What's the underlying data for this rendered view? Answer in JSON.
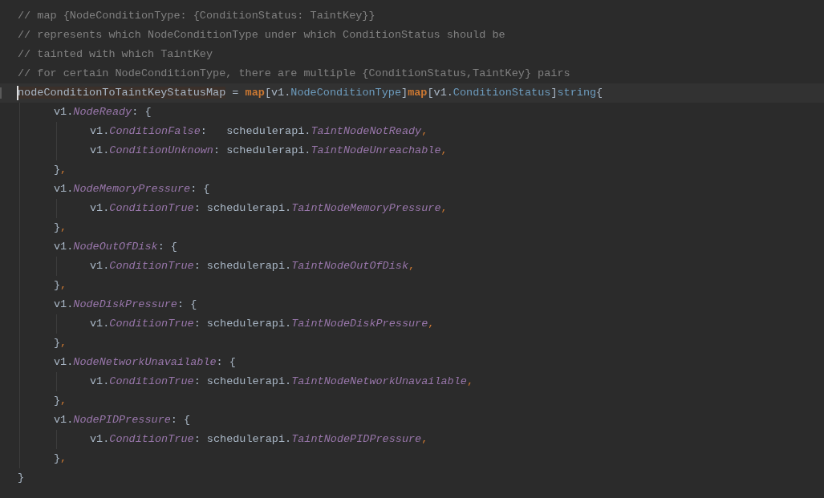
{
  "editor": {
    "lines": [
      {
        "current": false,
        "tokens": [
          {
            "kind": "comment",
            "text": "// map {NodeConditionType: {ConditionStatus: TaintKey}}"
          }
        ]
      },
      {
        "current": false,
        "tokens": [
          {
            "kind": "comment",
            "text": "// represents which NodeConditionType under which ConditionStatus should be"
          }
        ]
      },
      {
        "current": false,
        "tokens": [
          {
            "kind": "comment",
            "text": "// tainted with which TaintKey"
          }
        ]
      },
      {
        "current": false,
        "tokens": [
          {
            "kind": "comment",
            "text": "// for certain NodeConditionType, there are multiple {ConditionStatus,TaintKey} pairs"
          }
        ]
      },
      {
        "current": true,
        "tokens": [
          {
            "kind": "usage",
            "text": "nodeConditionToTaintKeyStatusMap"
          },
          {
            "kind": "plain",
            "text": " = "
          },
          {
            "kind": "keyword",
            "text": "map"
          },
          {
            "kind": "plain",
            "text": "[v1."
          },
          {
            "kind": "type",
            "text": "NodeConditionType"
          },
          {
            "kind": "plain",
            "text": "]"
          },
          {
            "kind": "keyword",
            "text": "map"
          },
          {
            "kind": "plain",
            "text": "[v1."
          },
          {
            "kind": "type",
            "text": "ConditionStatus"
          },
          {
            "kind": "plain",
            "text": "]"
          },
          {
            "kind": "type",
            "text": "string"
          },
          {
            "kind": "plain",
            "text": "{"
          }
        ],
        "children": [
          {
            "current": false,
            "tokens": [
              {
                "kind": "plain",
                "text": "v1."
              },
              {
                "kind": "field",
                "text": "NodeReady"
              },
              {
                "kind": "plain",
                "text": ": {"
              }
            ],
            "children": [
              {
                "current": false,
                "tokens": [
                  {
                    "kind": "plain",
                    "text": "v1."
                  },
                  {
                    "kind": "field",
                    "text": "ConditionFalse"
                  },
                  {
                    "kind": "plain",
                    "text": ":   schedulerapi."
                  },
                  {
                    "kind": "field",
                    "text": "TaintNodeNotReady"
                  },
                  {
                    "kind": "punct",
                    "text": ","
                  }
                ]
              },
              {
                "current": false,
                "tokens": [
                  {
                    "kind": "plain",
                    "text": "v1."
                  },
                  {
                    "kind": "field",
                    "text": "ConditionUnknown"
                  },
                  {
                    "kind": "plain",
                    "text": ": schedulerapi."
                  },
                  {
                    "kind": "field",
                    "text": "TaintNodeUnreachable"
                  },
                  {
                    "kind": "punct",
                    "text": ","
                  }
                ]
              }
            ]
          },
          {
            "current": false,
            "tokens": [
              {
                "kind": "plain",
                "text": "}"
              },
              {
                "kind": "punct",
                "text": ","
              }
            ]
          },
          {
            "current": false,
            "tokens": [
              {
                "kind": "plain",
                "text": "v1."
              },
              {
                "kind": "field",
                "text": "NodeMemoryPressure"
              },
              {
                "kind": "plain",
                "text": ": {"
              }
            ],
            "children": [
              {
                "current": false,
                "tokens": [
                  {
                    "kind": "plain",
                    "text": "v1."
                  },
                  {
                    "kind": "field",
                    "text": "ConditionTrue"
                  },
                  {
                    "kind": "plain",
                    "text": ": schedulerapi."
                  },
                  {
                    "kind": "field",
                    "text": "TaintNodeMemoryPressure"
                  },
                  {
                    "kind": "punct",
                    "text": ","
                  }
                ]
              }
            ]
          },
          {
            "current": false,
            "tokens": [
              {
                "kind": "plain",
                "text": "}"
              },
              {
                "kind": "punct",
                "text": ","
              }
            ]
          },
          {
            "current": false,
            "tokens": [
              {
                "kind": "plain",
                "text": "v1."
              },
              {
                "kind": "field",
                "text": "NodeOutOfDisk"
              },
              {
                "kind": "plain",
                "text": ": {"
              }
            ],
            "children": [
              {
                "current": false,
                "tokens": [
                  {
                    "kind": "plain",
                    "text": "v1."
                  },
                  {
                    "kind": "field",
                    "text": "ConditionTrue"
                  },
                  {
                    "kind": "plain",
                    "text": ": schedulerapi."
                  },
                  {
                    "kind": "field",
                    "text": "TaintNodeOutOfDisk"
                  },
                  {
                    "kind": "punct",
                    "text": ","
                  }
                ]
              }
            ]
          },
          {
            "current": false,
            "tokens": [
              {
                "kind": "plain",
                "text": "}"
              },
              {
                "kind": "punct",
                "text": ","
              }
            ]
          },
          {
            "current": false,
            "tokens": [
              {
                "kind": "plain",
                "text": "v1."
              },
              {
                "kind": "field",
                "text": "NodeDiskPressure"
              },
              {
                "kind": "plain",
                "text": ": {"
              }
            ],
            "children": [
              {
                "current": false,
                "tokens": [
                  {
                    "kind": "plain",
                    "text": "v1."
                  },
                  {
                    "kind": "field",
                    "text": "ConditionTrue"
                  },
                  {
                    "kind": "plain",
                    "text": ": schedulerapi."
                  },
                  {
                    "kind": "field",
                    "text": "TaintNodeDiskPressure"
                  },
                  {
                    "kind": "punct",
                    "text": ","
                  }
                ]
              }
            ]
          },
          {
            "current": false,
            "tokens": [
              {
                "kind": "plain",
                "text": "}"
              },
              {
                "kind": "punct",
                "text": ","
              }
            ]
          },
          {
            "current": false,
            "tokens": [
              {
                "kind": "plain",
                "text": "v1."
              },
              {
                "kind": "field",
                "text": "NodeNetworkUnavailable"
              },
              {
                "kind": "plain",
                "text": ": {"
              }
            ],
            "children": [
              {
                "current": false,
                "tokens": [
                  {
                    "kind": "plain",
                    "text": "v1."
                  },
                  {
                    "kind": "field",
                    "text": "ConditionTrue"
                  },
                  {
                    "kind": "plain",
                    "text": ": schedulerapi."
                  },
                  {
                    "kind": "field",
                    "text": "TaintNodeNetworkUnavailable"
                  },
                  {
                    "kind": "punct",
                    "text": ","
                  }
                ]
              }
            ]
          },
          {
            "current": false,
            "tokens": [
              {
                "kind": "plain",
                "text": "}"
              },
              {
                "kind": "punct",
                "text": ","
              }
            ]
          },
          {
            "current": false,
            "tokens": [
              {
                "kind": "plain",
                "text": "v1."
              },
              {
                "kind": "field",
                "text": "NodePIDPressure"
              },
              {
                "kind": "plain",
                "text": ": {"
              }
            ],
            "children": [
              {
                "current": false,
                "tokens": [
                  {
                    "kind": "plain",
                    "text": "v1."
                  },
                  {
                    "kind": "field",
                    "text": "ConditionTrue"
                  },
                  {
                    "kind": "plain",
                    "text": ": schedulerapi."
                  },
                  {
                    "kind": "field",
                    "text": "TaintNodePIDPressure"
                  },
                  {
                    "kind": "punct",
                    "text": ","
                  }
                ]
              }
            ]
          },
          {
            "current": false,
            "tokens": [
              {
                "kind": "plain",
                "text": "}"
              },
              {
                "kind": "punct",
                "text": ","
              }
            ]
          }
        ]
      },
      {
        "current": false,
        "tokens": [
          {
            "kind": "plain",
            "text": "}"
          }
        ]
      }
    ]
  }
}
